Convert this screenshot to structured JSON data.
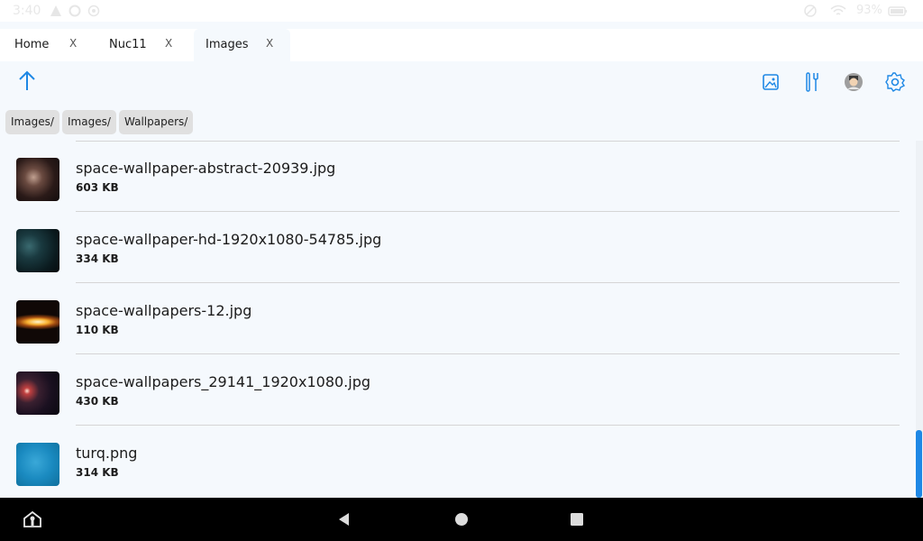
{
  "status": {
    "time": "3:40",
    "battery": "93%"
  },
  "tabs": [
    {
      "label": "Home",
      "close": "X",
      "active": false
    },
    {
      "label": "Nuc11",
      "close": "X",
      "active": false
    },
    {
      "label": "Images",
      "close": "X",
      "active": true
    }
  ],
  "toolbar": {
    "up_icon": "arrow-up-icon",
    "icons": [
      "image-icon",
      "tools-icon",
      "avatar-icon",
      "gear-icon"
    ],
    "accent": "#1e88e5"
  },
  "breadcrumbs": [
    "Images/",
    "Images/",
    "Wallpapers/"
  ],
  "files": [
    {
      "name": "space-wallpaper-abstract-20939.jpg",
      "size": "603 KB",
      "thumb": "abstract"
    },
    {
      "name": "space-wallpaper-hd-1920x1080-54785.jpg",
      "size": "334 KB",
      "thumb": "hd"
    },
    {
      "name": "space-wallpapers-12.jpg",
      "size": "110 KB",
      "thumb": "sunrise"
    },
    {
      "name": "space-wallpapers_29141_1920x1080.jpg",
      "size": "430 KB",
      "thumb": "planet"
    },
    {
      "name": "turq.png",
      "size": "314 KB",
      "thumb": "turq"
    }
  ],
  "navbar": {
    "icons": [
      "app-icon",
      "back-icon",
      "home-icon",
      "recents-icon"
    ]
  }
}
